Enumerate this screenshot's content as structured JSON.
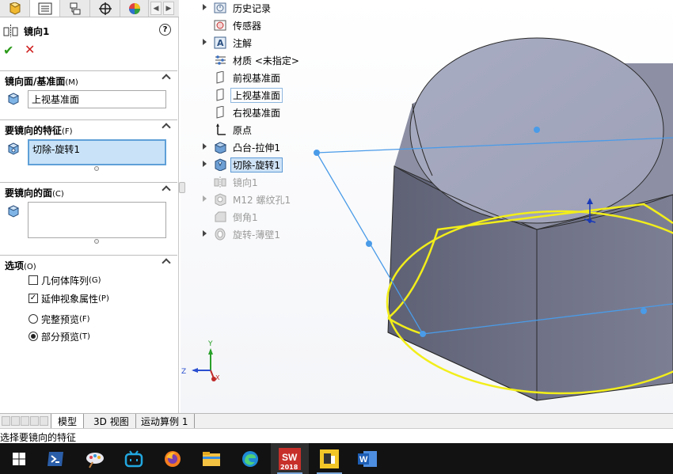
{
  "property_manager": {
    "tabs": [
      "feature-manager-icon",
      "property-manager-icon",
      "configuration-manager-icon",
      "dimxpert-icon",
      "display-manager-icon"
    ],
    "title": "镜向1",
    "help": "?",
    "ok_symbol": "✔",
    "cancel_symbol": "✕",
    "groups": {
      "mirror_face": {
        "title": "镜向面/基准面",
        "accel": "(M)",
        "value": "上视基准面"
      },
      "features": {
        "title": "要镜向的特征",
        "accel": "(F)",
        "value": "切除-旋转1"
      },
      "faces": {
        "title": "要镜向的面",
        "accel": "(C)",
        "value": ""
      },
      "options": {
        "title": "选项",
        "accel": "(O)",
        "geometry_pattern": {
          "label": "几何体阵列",
          "accel": "(G)",
          "checked": false
        },
        "propagate_visual": {
          "label": "延伸视象属性",
          "accel": "(P)",
          "checked": true
        },
        "full_preview": {
          "label": "完整预览",
          "accel": "(F)",
          "selected": false
        },
        "partial_preview": {
          "label": "部分预览",
          "accel": "(T)",
          "selected": true
        }
      }
    }
  },
  "feature_tree": {
    "items": [
      {
        "label": "历史记录",
        "icon": "history-icon",
        "expandable": true,
        "state": "normal"
      },
      {
        "label": "传感器",
        "icon": "sensor-icon",
        "expandable": false,
        "state": "normal"
      },
      {
        "label": "注解",
        "icon": "annotation-icon",
        "expandable": true,
        "state": "normal"
      },
      {
        "label": "材质 <未指定>",
        "icon": "material-icon",
        "expandable": false,
        "state": "normal"
      },
      {
        "label": "前视基准面",
        "icon": "plane-icon",
        "expandable": false,
        "state": "normal"
      },
      {
        "label": "上视基准面",
        "icon": "plane-icon",
        "expandable": false,
        "state": "boxed"
      },
      {
        "label": "右视基准面",
        "icon": "plane-icon",
        "expandable": false,
        "state": "normal"
      },
      {
        "label": "原点",
        "icon": "origin-icon",
        "expandable": false,
        "state": "normal"
      },
      {
        "label": "凸台-拉伸1",
        "icon": "boss-extrude-icon",
        "expandable": true,
        "state": "normal"
      },
      {
        "label": "切除-旋转1",
        "icon": "cut-revolve-icon",
        "expandable": true,
        "state": "selected"
      },
      {
        "label": "镜向1",
        "icon": "mirror-icon",
        "expandable": false,
        "state": "dim"
      },
      {
        "label": "M12 螺纹孔1",
        "icon": "hole-icon",
        "expandable": true,
        "state": "dim"
      },
      {
        "label": "倒角1",
        "icon": "chamfer-icon",
        "expandable": false,
        "state": "dim"
      },
      {
        "label": "旋转-薄壁1",
        "icon": "revolve-thin-icon",
        "expandable": true,
        "state": "dim"
      }
    ]
  },
  "triad": {
    "x": "X",
    "y": "Y",
    "z": "Z"
  },
  "bottom_tabs": [
    "模型",
    "3D 视图",
    "运动算例 1"
  ],
  "status": "选择要镜向的特征",
  "taskbar": {
    "apps": [
      "start-icon",
      "powershell-icon",
      "paint-icon",
      "bilibili-icon",
      "firefox-icon",
      "file-explorer-icon",
      "edge-icon",
      "solidworks-icon",
      "edrawings-icon",
      "word-icon"
    ],
    "solidworks_badge": "2018"
  },
  "colors": {
    "preview_yellow": "#f2ee1a",
    "plane_blue": "#4a9be8",
    "model_gray": "#6d7086",
    "selection_blue": "#c9e2f7"
  }
}
